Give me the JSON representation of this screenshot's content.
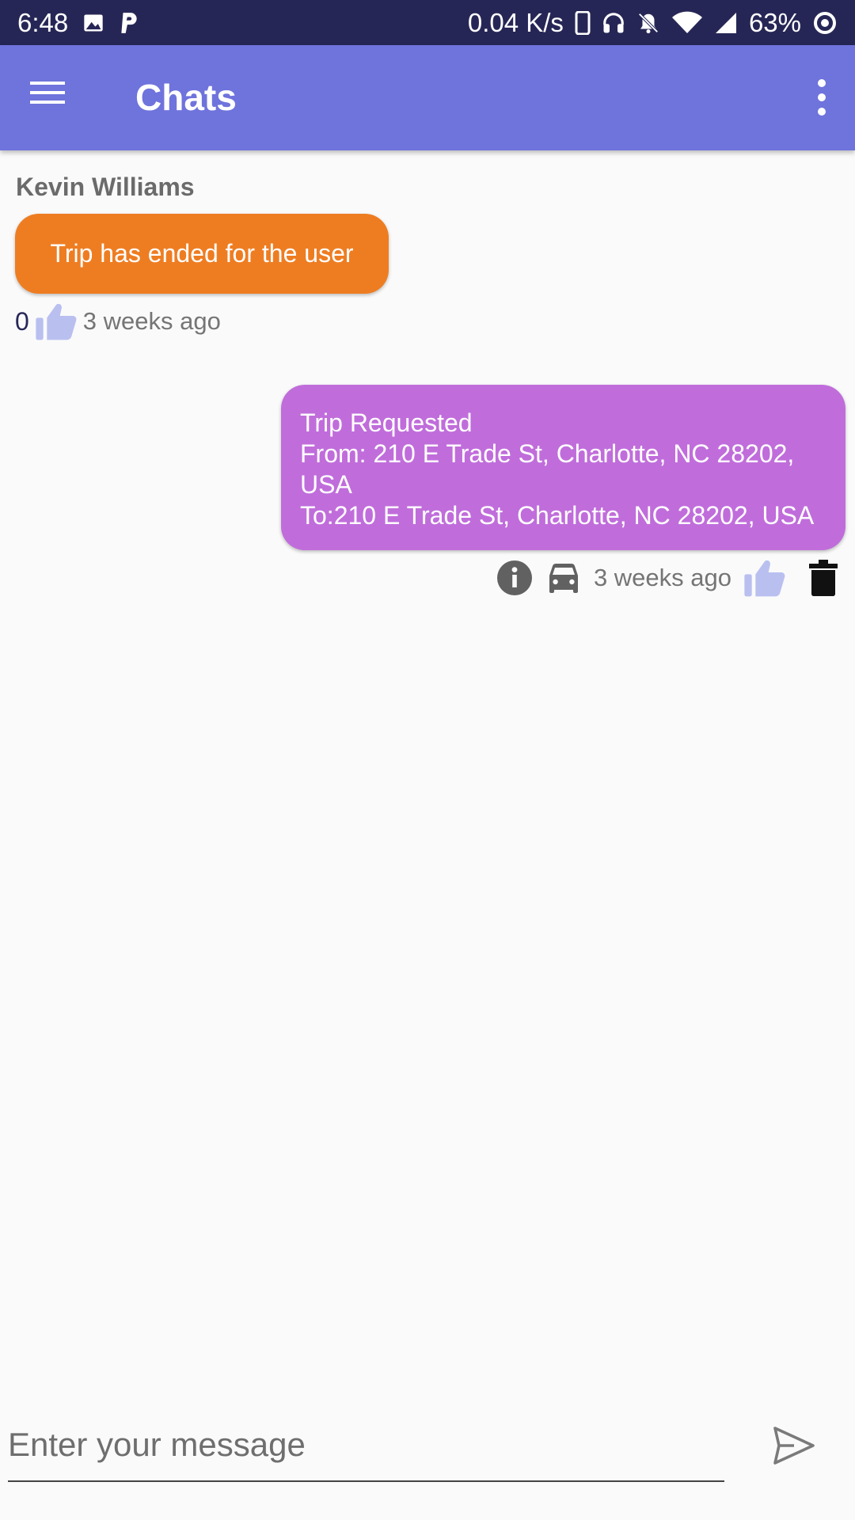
{
  "status_bar": {
    "time": "6:48",
    "net_speed": "0.04 K/s",
    "battery": "63%",
    "icons": [
      "image-icon",
      "p-app-icon",
      "phone-icon",
      "headphones-icon",
      "bell-off-icon",
      "wifi-icon",
      "signal-icon",
      "battery-ring-icon"
    ]
  },
  "app_bar": {
    "title": "Chats",
    "menu_icon": "hamburger-icon",
    "overflow_icon": "more-vert-icon",
    "color": "#6f73dc"
  },
  "messages": [
    {
      "direction": "incoming",
      "sender": "Kevin Williams",
      "text": "Trip has ended for the user",
      "likes": "0",
      "time": "3 weeks ago",
      "bubble_color": "#ee7d22"
    },
    {
      "direction": "outgoing",
      "lines": [
        "Trip Requested",
        "From: 210 E Trade St, Charlotte, NC 28202,",
        "USA",
        "To:210 E Trade St, Charlotte, NC 28202, USA"
      ],
      "time": "3 weeks ago",
      "bubble_color": "#c06ddb",
      "icons": [
        "info-icon",
        "car-icon",
        "thumb-up-icon",
        "trash-icon"
      ]
    }
  ],
  "composer": {
    "placeholder": "Enter your message",
    "value": "",
    "send_icon": "send-icon"
  }
}
